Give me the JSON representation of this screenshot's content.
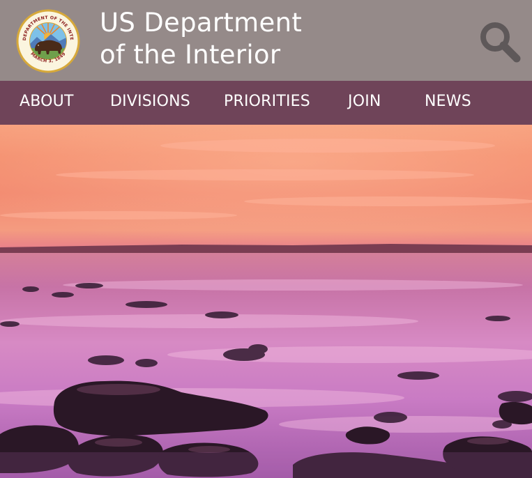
{
  "header": {
    "title_line1": "US Department",
    "title_line2": "of the Interior",
    "seal": {
      "top_text": "U.S. DEPARTMENT OF THE INTERIOR",
      "bottom_text": "MARCH 3, 1849"
    },
    "search_icon": "search-icon"
  },
  "nav": {
    "items": [
      {
        "label": "ABOUT"
      },
      {
        "label": "DIVISIONS"
      },
      {
        "label": "PRIORITIES"
      },
      {
        "label": "JOIN"
      },
      {
        "label": "NEWS"
      }
    ]
  },
  "hero": {
    "description_icon": "sunset-coast-photo"
  },
  "colors": {
    "header_bg": "#958a89",
    "nav_bg": "#6f4459",
    "text": "#ffffff",
    "search_icon": "#5e5859"
  }
}
